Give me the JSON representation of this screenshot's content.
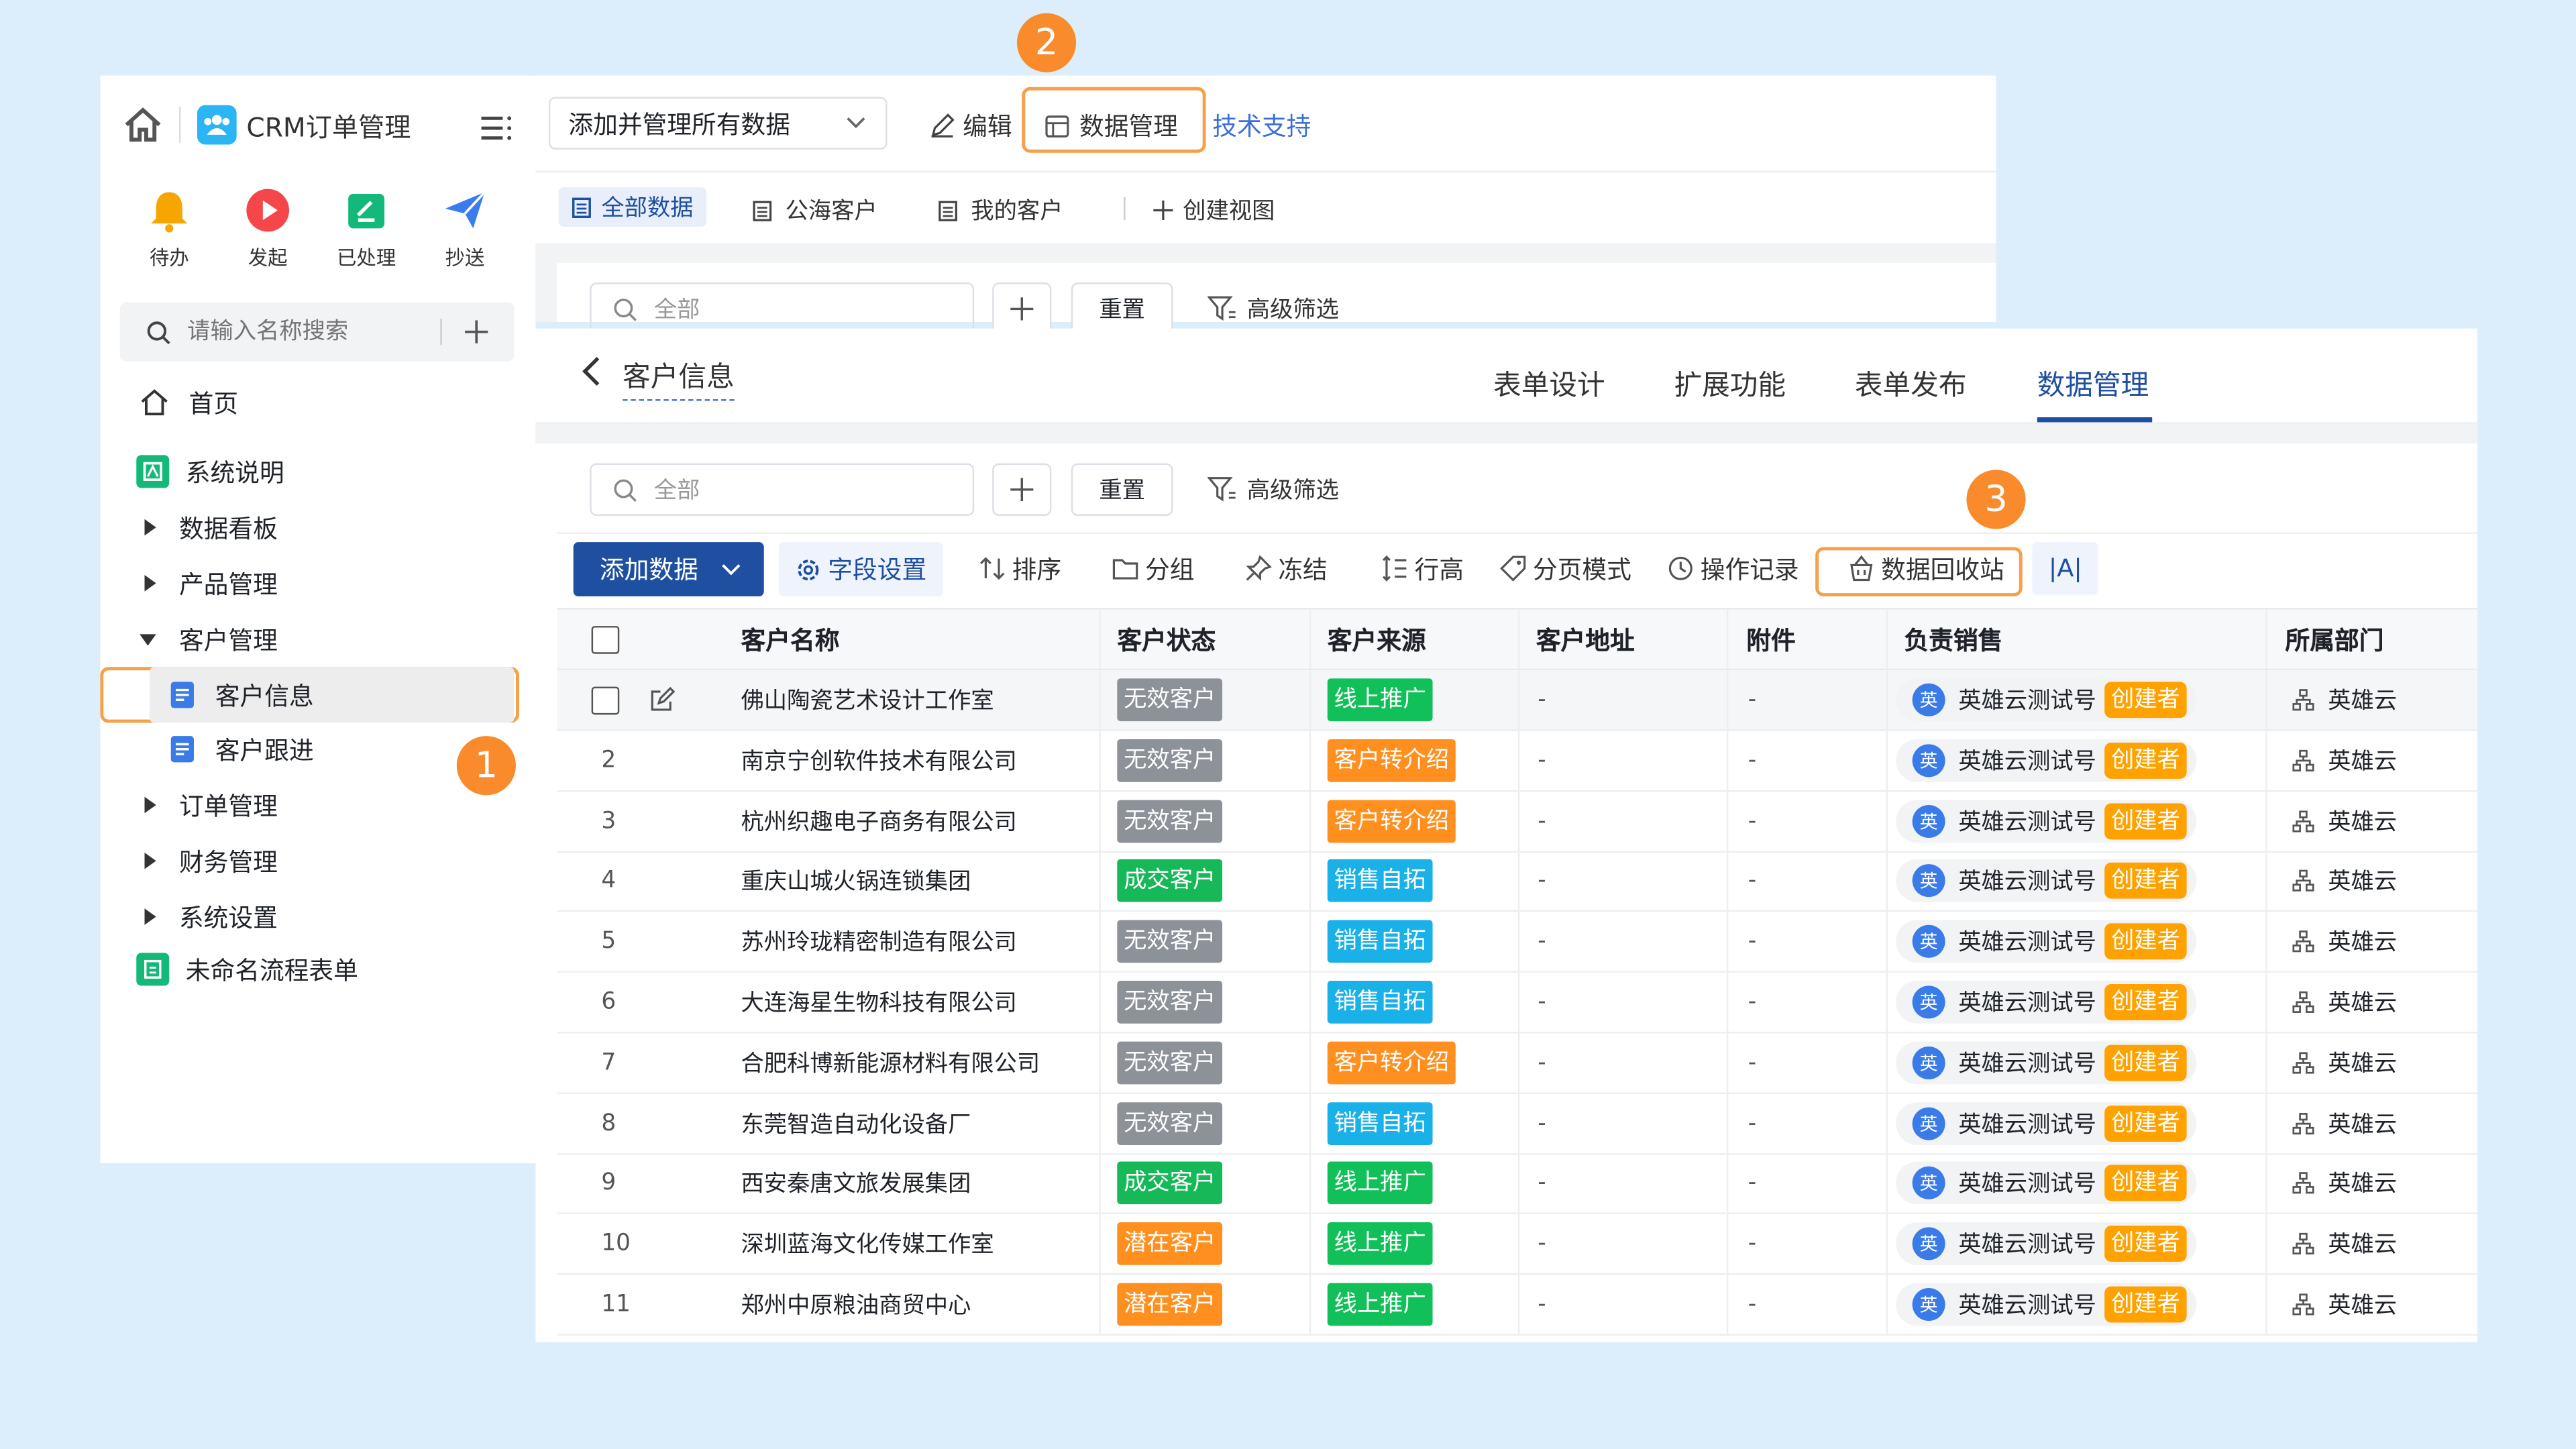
{
  "sidebar": {
    "app_title": "CRM订单管理",
    "quick_actions": [
      {
        "label": "待办",
        "icon": "bell-icon",
        "color": "#f7a500"
      },
      {
        "label": "发起",
        "icon": "play-icon",
        "color": "#f5474a"
      },
      {
        "label": "已处理",
        "icon": "check-doc-icon",
        "color": "#14b97a"
      },
      {
        "label": "抄送",
        "icon": "send-icon",
        "color": "#3a7cf0"
      }
    ],
    "search_placeholder": "请输入名称搜索",
    "nav": {
      "home": "首页",
      "sys_desc": "系统说明",
      "dashboard": "数据看板",
      "product": "产品管理",
      "customer": "客户管理",
      "customer_info": "客户信息",
      "customer_follow": "客户跟进",
      "order": "订单管理",
      "finance": "财务管理",
      "settings": "系统设置",
      "unnamed_form": "未命名流程表单"
    }
  },
  "topbar": {
    "view_select": "添加并管理所有数据",
    "edit": "编辑",
    "data_manage": "数据管理",
    "support": "技术支持",
    "tabs": [
      "全部数据",
      "公海客户",
      "我的客户"
    ],
    "create_view": "创建视图",
    "search_placeholder": "全部",
    "reset": "重置",
    "advanced_filter": "高级筛选"
  },
  "front": {
    "back_title": "客户信息",
    "tabs": [
      "表单设计",
      "扩展功能",
      "表单发布",
      "数据管理"
    ],
    "active_tab": "数据管理",
    "search_placeholder": "全部",
    "reset": "重置",
    "advanced_filter": "高级筛选",
    "toolbar": {
      "add": "添加数据",
      "fields": "字段设置",
      "sort": "排序",
      "group": "分组",
      "freeze": "冻结",
      "row_height": "行高",
      "paging": "分页模式",
      "log": "操作记录",
      "recycle": "数据回收站",
      "text_size": "|A|"
    },
    "columns": [
      "客户名称",
      "客户状态",
      "客户来源",
      "客户地址",
      "附件",
      "负责销售",
      "所属部门"
    ],
    "rows": [
      {
        "no": "",
        "name": "佛山陶瓷艺术设计工作室",
        "status": "无效客户",
        "status_type": "gray",
        "source": "线上推广",
        "source_type": "lgreen",
        "address": "-",
        "attach": "-",
        "avatar": "英",
        "sales": "英雄云测试号",
        "badge": "创建者",
        "dept": "英雄云"
      },
      {
        "no": "2",
        "name": "南京宁创软件技术有限公司",
        "status": "无效客户",
        "status_type": "gray",
        "source": "客户转介绍",
        "source_type": "orange",
        "address": "-",
        "attach": "-",
        "avatar": "英",
        "sales": "英雄云测试号",
        "badge": "创建者",
        "dept": "英雄云"
      },
      {
        "no": "3",
        "name": "杭州织趣电子商务有限公司",
        "status": "无效客户",
        "status_type": "gray",
        "source": "客户转介绍",
        "source_type": "orange",
        "address": "-",
        "attach": "-",
        "avatar": "英",
        "sales": "英雄云测试号",
        "badge": "创建者",
        "dept": "英雄云"
      },
      {
        "no": "4",
        "name": "重庆山城火锅连锁集团",
        "status": "成交客户",
        "status_type": "green",
        "source": "销售自拓",
        "source_type": "blue",
        "address": "-",
        "attach": "-",
        "avatar": "英",
        "sales": "英雄云测试号",
        "badge": "创建者",
        "dept": "英雄云"
      },
      {
        "no": "5",
        "name": "苏州玲珑精密制造有限公司",
        "status": "无效客户",
        "status_type": "gray",
        "source": "销售自拓",
        "source_type": "blue",
        "address": "-",
        "attach": "-",
        "avatar": "英",
        "sales": "英雄云测试号",
        "badge": "创建者",
        "dept": "英雄云"
      },
      {
        "no": "6",
        "name": "大连海星生物科技有限公司",
        "status": "无效客户",
        "status_type": "gray",
        "source": "销售自拓",
        "source_type": "blue",
        "address": "-",
        "attach": "-",
        "avatar": "英",
        "sales": "英雄云测试号",
        "badge": "创建者",
        "dept": "英雄云"
      },
      {
        "no": "7",
        "name": "合肥科博新能源材料有限公司",
        "status": "无效客户",
        "status_type": "gray",
        "source": "客户转介绍",
        "source_type": "orange",
        "address": "-",
        "attach": "-",
        "avatar": "英",
        "sales": "英雄云测试号",
        "badge": "创建者",
        "dept": "英雄云"
      },
      {
        "no": "8",
        "name": "东莞智造自动化设备厂",
        "status": "无效客户",
        "status_type": "gray",
        "source": "销售自拓",
        "source_type": "blue",
        "address": "-",
        "attach": "-",
        "avatar": "英",
        "sales": "英雄云测试号",
        "badge": "创建者",
        "dept": "英雄云"
      },
      {
        "no": "9",
        "name": "西安秦唐文旅发展集团",
        "status": "成交客户",
        "status_type": "green",
        "source": "线上推广",
        "source_type": "lgreen",
        "address": "-",
        "attach": "-",
        "avatar": "英",
        "sales": "英雄云测试号",
        "badge": "创建者",
        "dept": "英雄云"
      },
      {
        "no": "10",
        "name": "深圳蓝海文化传媒工作室",
        "status": "潜在客户",
        "status_type": "orange",
        "source": "线上推广",
        "source_type": "lgreen",
        "address": "-",
        "attach": "-",
        "avatar": "英",
        "sales": "英雄云测试号",
        "badge": "创建者",
        "dept": "英雄云"
      },
      {
        "no": "11",
        "name": "郑州中原粮油商贸中心",
        "status": "潜在客户",
        "status_type": "orange",
        "source": "线上推广",
        "source_type": "lgreen",
        "address": "-",
        "attach": "-",
        "avatar": "英",
        "sales": "英雄云测试号",
        "badge": "创建者",
        "dept": "英雄云"
      }
    ]
  },
  "callouts": [
    "1",
    "2",
    "3"
  ],
  "colors": {
    "primary": "#1f4fa0",
    "accent": "#f98b2c",
    "link": "#3a6fd8"
  }
}
